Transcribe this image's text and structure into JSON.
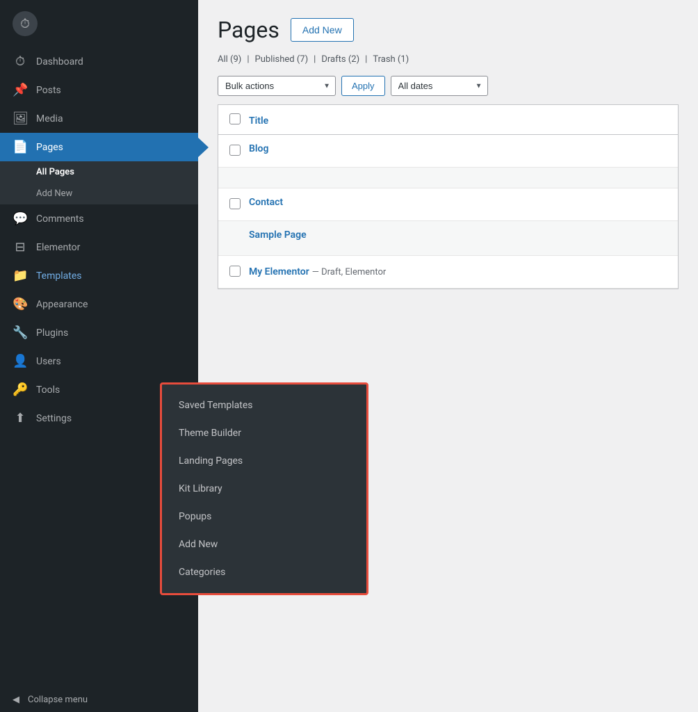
{
  "sidebar": {
    "items": [
      {
        "id": "dashboard",
        "label": "Dashboard",
        "icon": "⏱"
      },
      {
        "id": "posts",
        "label": "Posts",
        "icon": "📌"
      },
      {
        "id": "media",
        "label": "Media",
        "icon": "🖼"
      },
      {
        "id": "pages",
        "label": "Pages",
        "icon": "📄",
        "active": true
      },
      {
        "id": "comments",
        "label": "Comments",
        "icon": "💬"
      },
      {
        "id": "elementor",
        "label": "Elementor",
        "icon": "⊟"
      },
      {
        "id": "templates",
        "label": "Templates",
        "icon": "📁",
        "highlighted": true
      },
      {
        "id": "appearance",
        "label": "Appearance",
        "icon": "🎨"
      },
      {
        "id": "plugins",
        "label": "Plugins",
        "icon": "🔧"
      },
      {
        "id": "users",
        "label": "Users",
        "icon": "👤"
      },
      {
        "id": "tools",
        "label": "Tools",
        "icon": "🔑"
      },
      {
        "id": "settings",
        "label": "Settings",
        "icon": "⬆"
      }
    ],
    "pages_submenu": [
      {
        "id": "all-pages",
        "label": "All Pages",
        "active": true
      },
      {
        "id": "add-new",
        "label": "Add New"
      }
    ],
    "collapse_label": "Collapse menu"
  },
  "templates_popup": {
    "items": [
      {
        "id": "saved-templates",
        "label": "Saved Templates"
      },
      {
        "id": "theme-builder",
        "label": "Theme Builder"
      },
      {
        "id": "landing-pages",
        "label": "Landing Pages"
      },
      {
        "id": "kit-library",
        "label": "Kit Library"
      },
      {
        "id": "popups",
        "label": "Popups"
      },
      {
        "id": "add-new",
        "label": "Add New"
      },
      {
        "id": "categories",
        "label": "Categories"
      }
    ]
  },
  "main": {
    "page_title": "Pages",
    "add_new_label": "Add New",
    "filter": {
      "all_label": "All",
      "all_count": "(9)",
      "published_label": "Published",
      "published_count": "(7)",
      "drafts_label": "Drafts",
      "drafts_count": "(2)",
      "trash_label": "Trash",
      "trash_count": "(1)"
    },
    "toolbar": {
      "bulk_actions_label": "Bulk actions",
      "apply_label": "Apply",
      "all_dates_label": "All dates"
    },
    "table": {
      "title_col": "Title",
      "rows": [
        {
          "id": "blog",
          "title": "Blog",
          "meta": ""
        },
        {
          "id": "contact",
          "title": "Contact",
          "meta": ""
        },
        {
          "id": "my-elementor",
          "title": "My Elementor",
          "meta": "— Draft, Elementor",
          "draft": true
        }
      ]
    },
    "sample_page_label": "Sample Page"
  }
}
